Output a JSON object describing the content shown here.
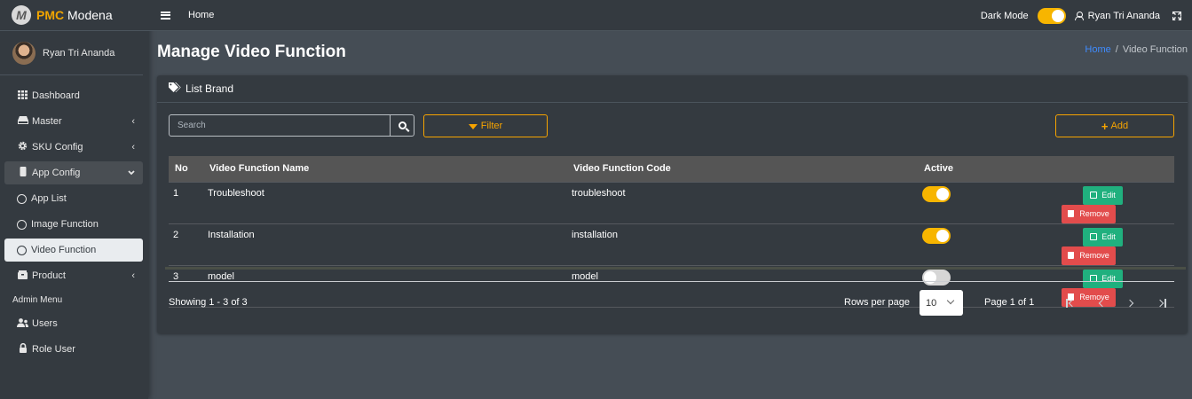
{
  "brand": {
    "prefix": "PMC",
    "name": "Modena",
    "logo_letter": "M"
  },
  "sidebar": {
    "user_name": "Ryan Tri Ananda",
    "items": [
      {
        "label": "Dashboard",
        "icon": "grid-icon"
      },
      {
        "label": "Master",
        "icon": "drive-icon",
        "chevron": "‹"
      },
      {
        "label": "SKU Config",
        "icon": "gear-icon",
        "chevron": "‹"
      },
      {
        "label": "App Config",
        "icon": "mobile-icon",
        "chevron": "⌄"
      },
      {
        "label": "App List",
        "icon": "circle-icon"
      },
      {
        "label": "Image Function",
        "icon": "circle-icon"
      },
      {
        "label": "Video Function",
        "icon": "circle-icon"
      },
      {
        "label": "Product",
        "icon": "box-icon",
        "chevron": "‹"
      }
    ],
    "admin_header": "Admin Menu",
    "admin_items": [
      {
        "label": "Users",
        "icon": "users-icon"
      },
      {
        "label": "Role User",
        "icon": "lock-icon"
      }
    ]
  },
  "topbar": {
    "home": "Home",
    "dark_mode_label": "Dark Mode",
    "dark_mode_on": true,
    "user_name": "Ryan Tri Ananda"
  },
  "page": {
    "title": "Manage Video Function",
    "breadcrumb": {
      "home": "Home",
      "separator": "/",
      "current": "Video Function"
    }
  },
  "card": {
    "title": "List Brand",
    "search_placeholder": "Search",
    "filter_label": "Filter",
    "add_label": "Add"
  },
  "table": {
    "headers": [
      "No",
      "Video Function Name",
      "Video Function Code",
      "Active"
    ],
    "rows": [
      {
        "no": "1",
        "name": "Troubleshoot",
        "code": "troubleshoot",
        "active": true
      },
      {
        "no": "2",
        "name": "Installation",
        "code": "installation",
        "active": true
      },
      {
        "no": "3",
        "name": "model",
        "code": "model",
        "active": false
      }
    ],
    "edit_label": "Edit",
    "remove_label": "Remove"
  },
  "footer": {
    "showing": "Showing 1 - 3 of 3",
    "rows_per_page_label": "Rows per page",
    "rows_per_page_value": "10",
    "page_info": "Page 1 of 1"
  },
  "colors": {
    "accent": "#f7a400",
    "edit": "#20b07e",
    "remove": "#e24c4c",
    "link": "#3f8cff"
  }
}
